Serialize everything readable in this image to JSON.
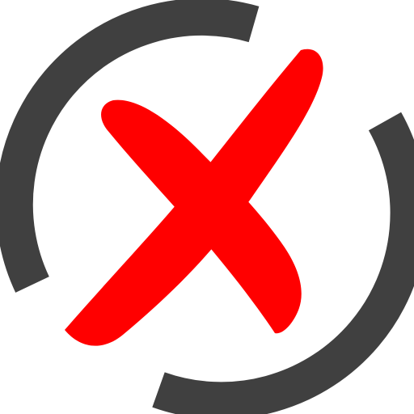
{
  "icon": {
    "name": "cancel-x-icon",
    "ring_color": "#404040",
    "mark_color": "#ff0000",
    "background": "#ffffff"
  }
}
